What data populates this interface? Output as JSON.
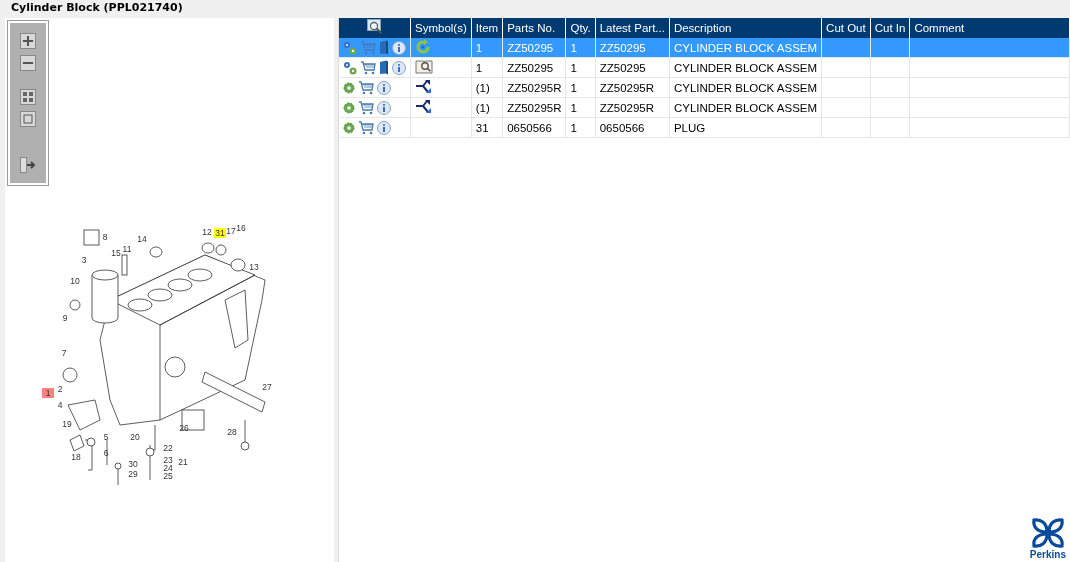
{
  "window": {
    "title": "Cylinder Block (PPL021740)"
  },
  "diagram": {
    "callouts": [
      {
        "label": "8"
      },
      {
        "label": "14"
      },
      {
        "label": "12"
      },
      {
        "label": "31",
        "color": "#ffff00"
      },
      {
        "label": "17"
      },
      {
        "label": "16"
      },
      {
        "label": "11"
      },
      {
        "label": "15"
      },
      {
        "label": "3"
      },
      {
        "label": "13"
      },
      {
        "label": "10"
      },
      {
        "label": "9"
      },
      {
        "label": "7"
      },
      {
        "label": "1",
        "color": "#ff8080"
      },
      {
        "label": "2"
      },
      {
        "label": "4"
      },
      {
        "label": "27"
      },
      {
        "label": "26"
      },
      {
        "label": "19"
      },
      {
        "label": "5"
      },
      {
        "label": "20"
      },
      {
        "label": "22"
      },
      {
        "label": "28"
      },
      {
        "label": "18"
      },
      {
        "label": "6"
      },
      {
        "label": "23"
      },
      {
        "label": "21"
      },
      {
        "label": "24"
      },
      {
        "label": "30"
      },
      {
        "label": "29"
      },
      {
        "label": "25"
      }
    ]
  },
  "table": {
    "columns": [
      "",
      "Symbol(s)",
      "Item",
      "Parts No.",
      "Qty.",
      "Latest Part...",
      "Description",
      "Cut Out",
      "Cut In",
      "Comment"
    ],
    "rows": [
      {
        "selected": true,
        "icons": {
          "kind": "assembly"
        },
        "symbol": {
          "kind": "replaced"
        },
        "cells": [
          "",
          "",
          "1",
          "ZZ50295",
          "1",
          "ZZ50295",
          "CYLINDER BLOCK ASSEM",
          "",
          "",
          ""
        ]
      },
      {
        "selected": false,
        "icons": {
          "kind": "assembly"
        },
        "symbol": {
          "kind": "illustration"
        },
        "cells": [
          "",
          "",
          "1",
          "ZZ50295",
          "1",
          "ZZ50295",
          "CYLINDER BLOCK ASSEM",
          "",
          "",
          ""
        ]
      },
      {
        "selected": false,
        "icons": {
          "kind": "part"
        },
        "symbol": {
          "kind": "alternative"
        },
        "cells": [
          "",
          "",
          "(1)",
          "ZZ50295R",
          "1",
          "ZZ50295R",
          "CYLINDER BLOCK ASSEM",
          "",
          "",
          ""
        ]
      },
      {
        "selected": false,
        "icons": {
          "kind": "part"
        },
        "symbol": {
          "kind": "alternative"
        },
        "cells": [
          "",
          "",
          "(1)",
          "ZZ50295R",
          "1",
          "ZZ50295R",
          "CYLINDER BLOCK ASSEM",
          "",
          "",
          ""
        ]
      },
      {
        "selected": false,
        "icons": {
          "kind": "part"
        },
        "cells": [
          "",
          "",
          "31",
          "0650566",
          "1",
          "0650566",
          "PLUG",
          "",
          "",
          ""
        ]
      }
    ]
  },
  "logo": {
    "text": "Perkins"
  }
}
